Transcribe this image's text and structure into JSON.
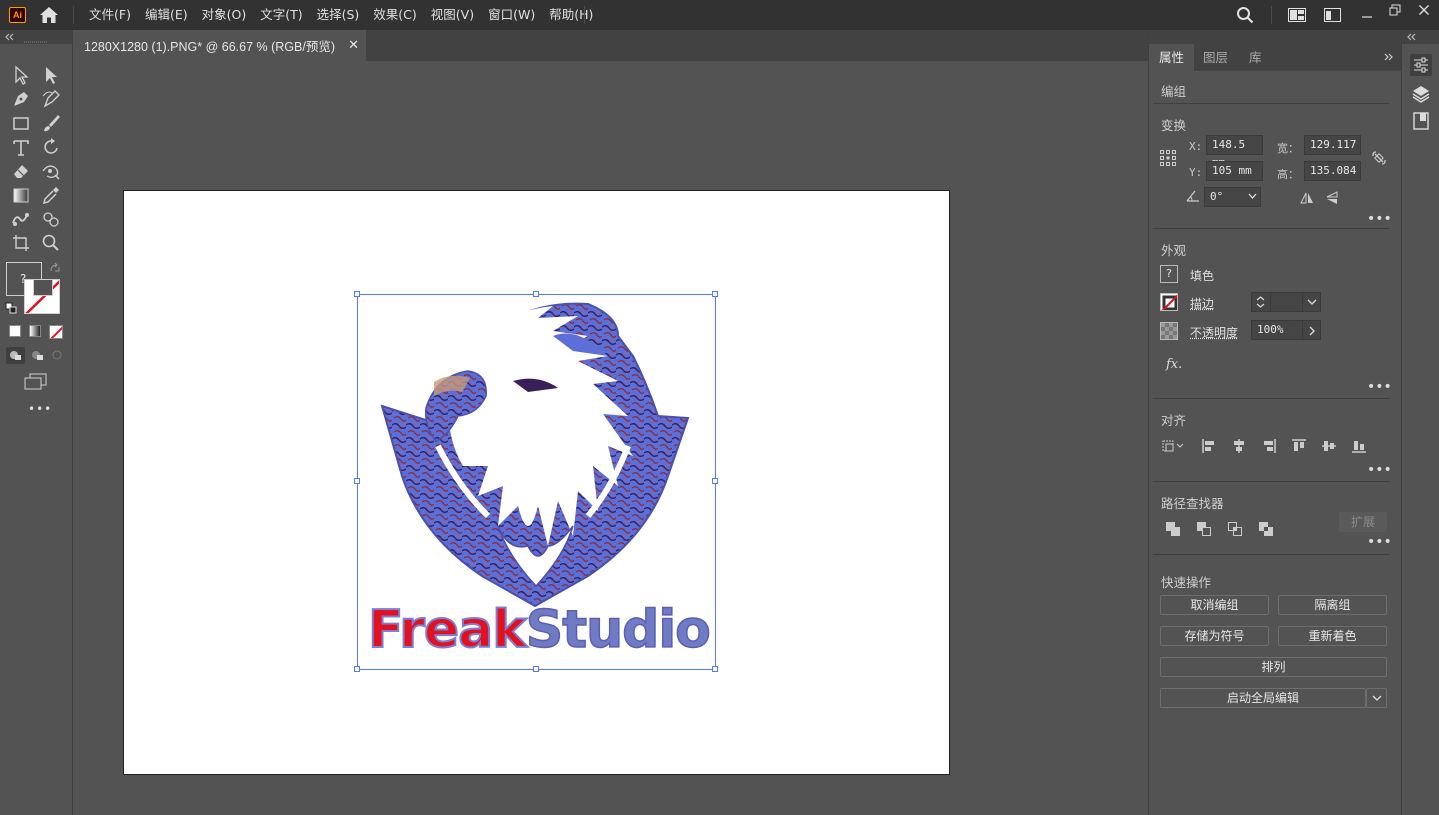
{
  "app": {
    "logo_text": "Ai"
  },
  "menu": {
    "items": [
      "文件(F)",
      "编辑(E)",
      "对象(O)",
      "文字(T)",
      "选择(S)",
      "效果(C)",
      "视图(V)",
      "窗口(W)",
      "帮助(H)"
    ]
  },
  "document": {
    "tab_title": "1280X1280 (1).PNG* @ 66.67 % (RGB/预览)",
    "close_glyph": "✕"
  },
  "artwork": {
    "text_part1": "Freak",
    "text_part2": "Studio"
  },
  "tools": {
    "fill_unknown_glyph": "?"
  },
  "properties": {
    "tabs": [
      "属性",
      "图层",
      "库"
    ],
    "object_type": "编组",
    "transform": {
      "title": "变换",
      "x_label": "X:",
      "x_value": "148.5 mm",
      "y_label": "Y:",
      "y_value": "105 mm",
      "w_label": "宽：",
      "w_value": "129.117",
      "h_label": "高：",
      "h_value": "135.084",
      "angle_value": "0°"
    },
    "appearance": {
      "title": "外观",
      "fill_label": "填色",
      "fill_glyph": "?",
      "stroke_label": "描边",
      "opacity_label": "不透明度",
      "opacity_value": "100%",
      "fx_label": "fx."
    },
    "align": {
      "title": "对齐"
    },
    "pathfinder": {
      "title": "路径查找器",
      "expand_label": "扩展"
    },
    "quick_actions": {
      "title": "快速操作",
      "ungroup": "取消编组",
      "isolate": "隔离组",
      "save_symbol": "存储为符号",
      "recolor": "重新着色",
      "arrange": "排列",
      "global_edit": "启动全局编辑"
    },
    "more_glyph": "•••"
  },
  "colors": {
    "selection": "#4e7bff",
    "eagle_fill": "#5c6fd6",
    "eagle_dark": "#3a1f58",
    "freak_red": "#e3101e",
    "studio_blue": "#6f7cc4"
  }
}
